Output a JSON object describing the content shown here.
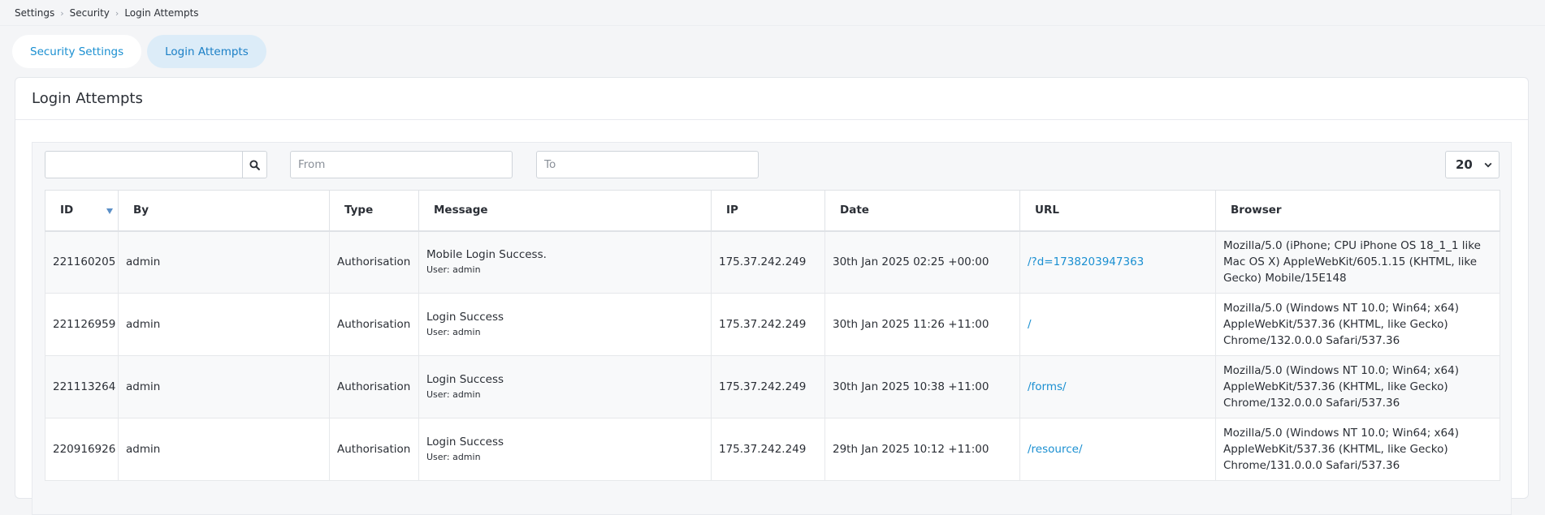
{
  "breadcrumb": [
    "Settings",
    "Security",
    "Login Attempts"
  ],
  "tabs": [
    {
      "label": "Security Settings",
      "active": false
    },
    {
      "label": "Login Attempts",
      "active": true
    }
  ],
  "panel": {
    "title": "Login Attempts"
  },
  "filters": {
    "search_value": "",
    "search_icon": "search-icon",
    "from_placeholder": "From",
    "to_placeholder": "To",
    "page_size": "20",
    "page_size_icon": "chevron-down-icon"
  },
  "colors": {
    "accent": "#1a8fd1",
    "active_tab_bg": "#dcecf8",
    "sort_arrow": "#5b8fc7"
  },
  "table": {
    "columns": [
      "ID",
      "By",
      "Type",
      "Message",
      "IP",
      "Date",
      "URL",
      "Browser"
    ],
    "sort_column": "ID",
    "sort_direction": "desc",
    "rows": [
      {
        "id": "221160205",
        "by": "admin",
        "type": "Authorisation",
        "message": "Mobile Login Success.",
        "message_sub": "User: admin",
        "ip": "175.37.242.249",
        "date": "30th Jan 2025 02:25 +00:00",
        "url": "/?d=1738203947363",
        "browser": "Mozilla/5.0 (iPhone; CPU iPhone OS 18_1_1 like Mac OS X) AppleWebKit/605.1.15 (KHTML, like Gecko) Mobile/15E148"
      },
      {
        "id": "221126959",
        "by": "admin",
        "type": "Authorisation",
        "message": "Login Success",
        "message_sub": "User: admin",
        "ip": "175.37.242.249",
        "date": "30th Jan 2025 11:26 +11:00",
        "url": "/",
        "browser": "Mozilla/5.0 (Windows NT 10.0; Win64; x64) AppleWebKit/537.36 (KHTML, like Gecko) Chrome/132.0.0.0 Safari/537.36"
      },
      {
        "id": "221113264",
        "by": "admin",
        "type": "Authorisation",
        "message": "Login Success",
        "message_sub": "User: admin",
        "ip": "175.37.242.249",
        "date": "30th Jan 2025 10:38 +11:00",
        "url": "/forms/",
        "browser": "Mozilla/5.0 (Windows NT 10.0; Win64; x64) AppleWebKit/537.36 (KHTML, like Gecko) Chrome/132.0.0.0 Safari/537.36"
      },
      {
        "id": "220916926",
        "by": "admin",
        "type": "Authorisation",
        "message": "Login Success",
        "message_sub": "User: admin",
        "ip": "175.37.242.249",
        "date": "29th Jan 2025 10:12 +11:00",
        "url": "/resource/",
        "browser": "Mozilla/5.0 (Windows NT 10.0; Win64; x64) AppleWebKit/537.36 (KHTML, like Gecko) Chrome/131.0.0.0 Safari/537.36"
      }
    ]
  }
}
